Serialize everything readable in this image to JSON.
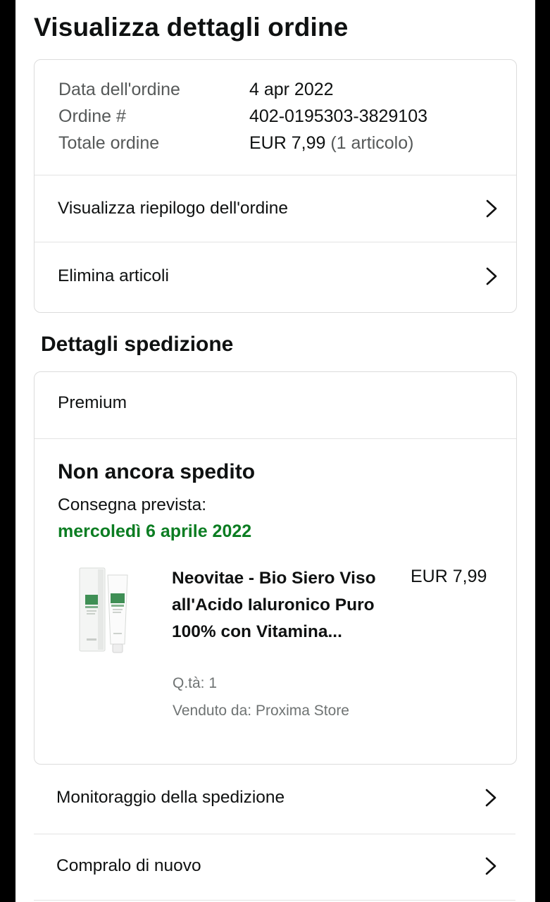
{
  "page": {
    "title": "Visualizza dettagli ordine"
  },
  "order": {
    "date_label": "Data dell'ordine",
    "date_value": "4 apr 2022",
    "number_label": "Ordine #",
    "number_value": "402-0195303-3829103",
    "total_label": "Totale ordine",
    "total_value": "EUR 7,99",
    "total_items": "(1 articolo)",
    "links": [
      {
        "label": "Visualizza riepilogo dell'ordine",
        "icon": "chevron-right-icon"
      },
      {
        "label": "Elimina articoli",
        "icon": "chevron-right-icon"
      }
    ]
  },
  "shipment": {
    "section_title": "Dettagli spedizione",
    "service": "Premium",
    "status": "Non ancora spedito",
    "delivery_label": "Consegna prevista:",
    "delivery_date": "mercoledì 6 aprile 2022",
    "delivery_color": "#0b7d22",
    "product": {
      "title": "Neovitae - Bio Siero Viso all'Acido Ialuronico Puro 100% con Vitamina...",
      "price": "EUR 7,99",
      "qty": "Q.tà: 1",
      "seller": "Venduto da: Proxima Store"
    }
  },
  "actions": [
    {
      "label": "Monitoraggio della spedizione",
      "icon": "chevron-right-icon"
    },
    {
      "label": "Compralo di nuovo",
      "icon": "chevron-right-icon"
    }
  ]
}
